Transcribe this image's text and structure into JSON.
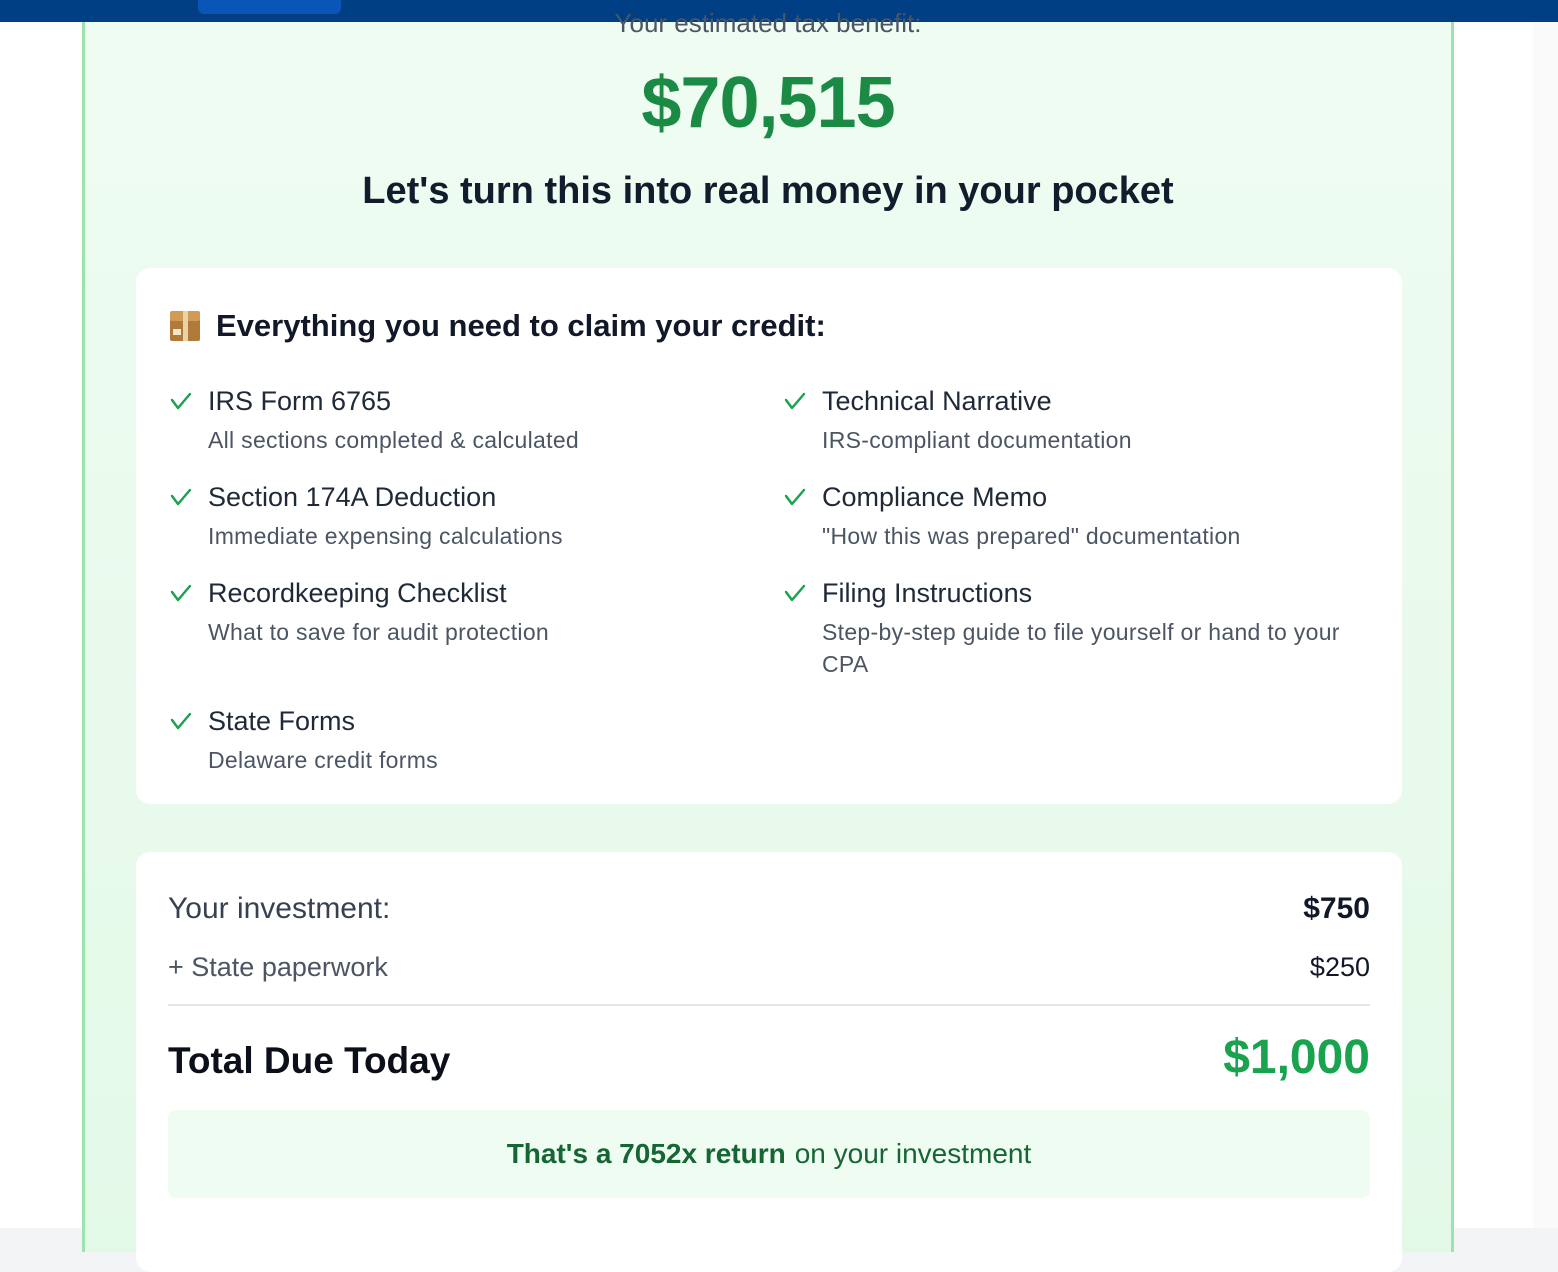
{
  "summary": {
    "estimate_label": "Your estimated tax benefit:",
    "amount": "$70,515",
    "headline": "Let's turn this into real money in your pocket"
  },
  "features": {
    "title_icon": "package-icon",
    "title": "Everything you need to claim your credit:",
    "items": [
      {
        "title": "IRS Form 6765",
        "desc": "All sections completed & calculated"
      },
      {
        "title": "Technical Narrative",
        "desc": "IRS-compliant documentation"
      },
      {
        "title": "Section 174A Deduction",
        "desc": "Immediate expensing calculations"
      },
      {
        "title": "Compliance Memo",
        "desc": "\"How this was prepared\" documentation"
      },
      {
        "title": "Recordkeeping Checklist",
        "desc": "What to save for audit protection"
      },
      {
        "title": "Filing Instructions",
        "desc": "Step-by-step guide to file yourself or hand to your CPA"
      },
      {
        "title": "State Forms",
        "desc": "Delaware credit forms"
      }
    ]
  },
  "pricing": {
    "investment_label": "Your investment:",
    "investment_value": "$750",
    "state_label": "+ State paperwork",
    "state_value": "$250",
    "total_label": "Total Due Today",
    "total_value": "$1,000",
    "return_bold": "That's a 7052x return",
    "return_rest": "on your investment"
  },
  "colors": {
    "accent_green": "#1a8a44",
    "total_green": "#1aa34f",
    "topbar_blue": "#003f84",
    "check_green": "#16a34a"
  }
}
